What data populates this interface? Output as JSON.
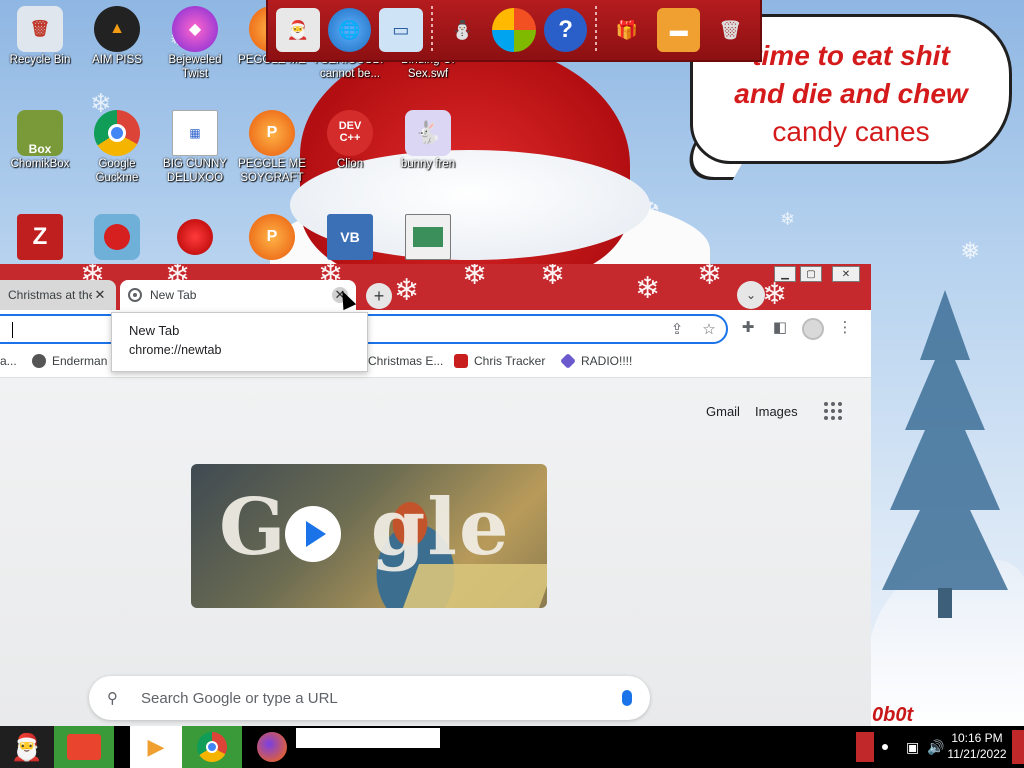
{
  "desktop": {
    "icons": [
      {
        "label": "Recycle Bin",
        "icon": "recycle-bin-icon"
      },
      {
        "label": "AIM PISS",
        "icon": "aimp-icon"
      },
      {
        "label": "Bejeweled Twist",
        "icon": "bejeweled-icon"
      },
      {
        "label": "PEGGLE ME",
        "icon": "peggle-icon"
      },
      {
        "label": "I SERIOUSLY cannot be...",
        "icon": "globe-icon"
      },
      {
        "label": "Binding Of Sex.swf",
        "icon": "flash-file-icon"
      },
      {
        "label": "ChomikBox",
        "icon": "chomikbox-icon"
      },
      {
        "label": "Google Guckme",
        "icon": "chrome-icon"
      },
      {
        "label": "BIG CUNNY DELUXOO",
        "icon": "document-icon"
      },
      {
        "label": "PEGGLE ME SOYGRAFT",
        "icon": "peggle-icon"
      },
      {
        "label": "Clion",
        "icon": "dev-cpp-icon"
      },
      {
        "label": "bunny fren",
        "icon": "bunny-icon"
      },
      {
        "label": "",
        "icon": "filezilla-icon"
      },
      {
        "label": "",
        "icon": "angry-birds-icon"
      },
      {
        "label": "",
        "icon": "red-creature-icon"
      },
      {
        "label": "",
        "icon": "peggle-icon"
      },
      {
        "label": "",
        "icon": "visual-basic-icon"
      },
      {
        "label": "",
        "icon": "window-app-icon"
      }
    ],
    "dev_icon_text": "DEV C++",
    "vb_icon_text": "VB",
    "box_icon_text": "Box"
  },
  "wallpaper": {
    "bubble_line1": "time to eat shit",
    "bubble_line2": "and die and chew",
    "bubble_line3": "candy canes",
    "signature": "0b0t"
  },
  "quicklaunch": {
    "items": [
      "computer-santa-icon",
      "globe-icon",
      "monitor-icon",
      "snowman-icon",
      "windows-logo-icon",
      "help-icon",
      "gift-icon",
      "folder-icon",
      "recycle-bin-icon"
    ]
  },
  "chrome": {
    "tabs": [
      {
        "title": "Christmas at the",
        "active": false
      },
      {
        "title": "New Tab",
        "active": true
      }
    ],
    "new_tab_symbol": "+",
    "close_symbol": "✕",
    "omnibox_value": "",
    "bookmarks": [
      {
        "label": "a...",
        "icon": "bookmark-icon"
      },
      {
        "label": "Enderman",
        "icon": "raccoon-icon"
      },
      {
        "label": "Christmas E...",
        "icon": "bookmark-icon"
      },
      {
        "label": "Chris Tracker",
        "icon": "red-star-icon"
      },
      {
        "label": "RADIO!!!!",
        "icon": "radio-diamond-icon"
      }
    ],
    "suggestion": {
      "title": "New Tab",
      "url": "chrome://newtab"
    },
    "ntp": {
      "gmail": "Gmail",
      "images": "Images",
      "doodle_text": "Go gle",
      "search_placeholder": "Search Google or type a URL"
    }
  },
  "taskbar": {
    "tasks": [
      "santa-start-icon",
      "folder-icon",
      "media-player-icon",
      "chrome-icon",
      "firefox-icon"
    ],
    "time": "10:16 PM",
    "date": "11/21/2022"
  }
}
